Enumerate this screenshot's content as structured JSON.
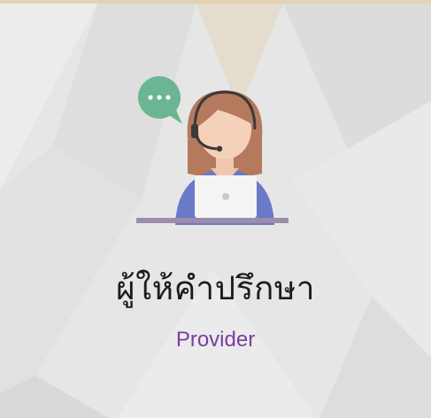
{
  "card": {
    "title": "ผู้ให้คำปรึกษา",
    "subtitle": "Provider",
    "icon": "customer-support-agent-icon",
    "speech_icon": "chat-bubble-icon"
  },
  "colors": {
    "background": "#e6e6e6",
    "title_text": "#1c1c1c",
    "subtitle_text": "#7b3fa0",
    "accent_top": "#e5d2b4",
    "speech_bubble": "#6bb592",
    "hair": "#b57a5e",
    "shirt": "#6a79c8"
  }
}
